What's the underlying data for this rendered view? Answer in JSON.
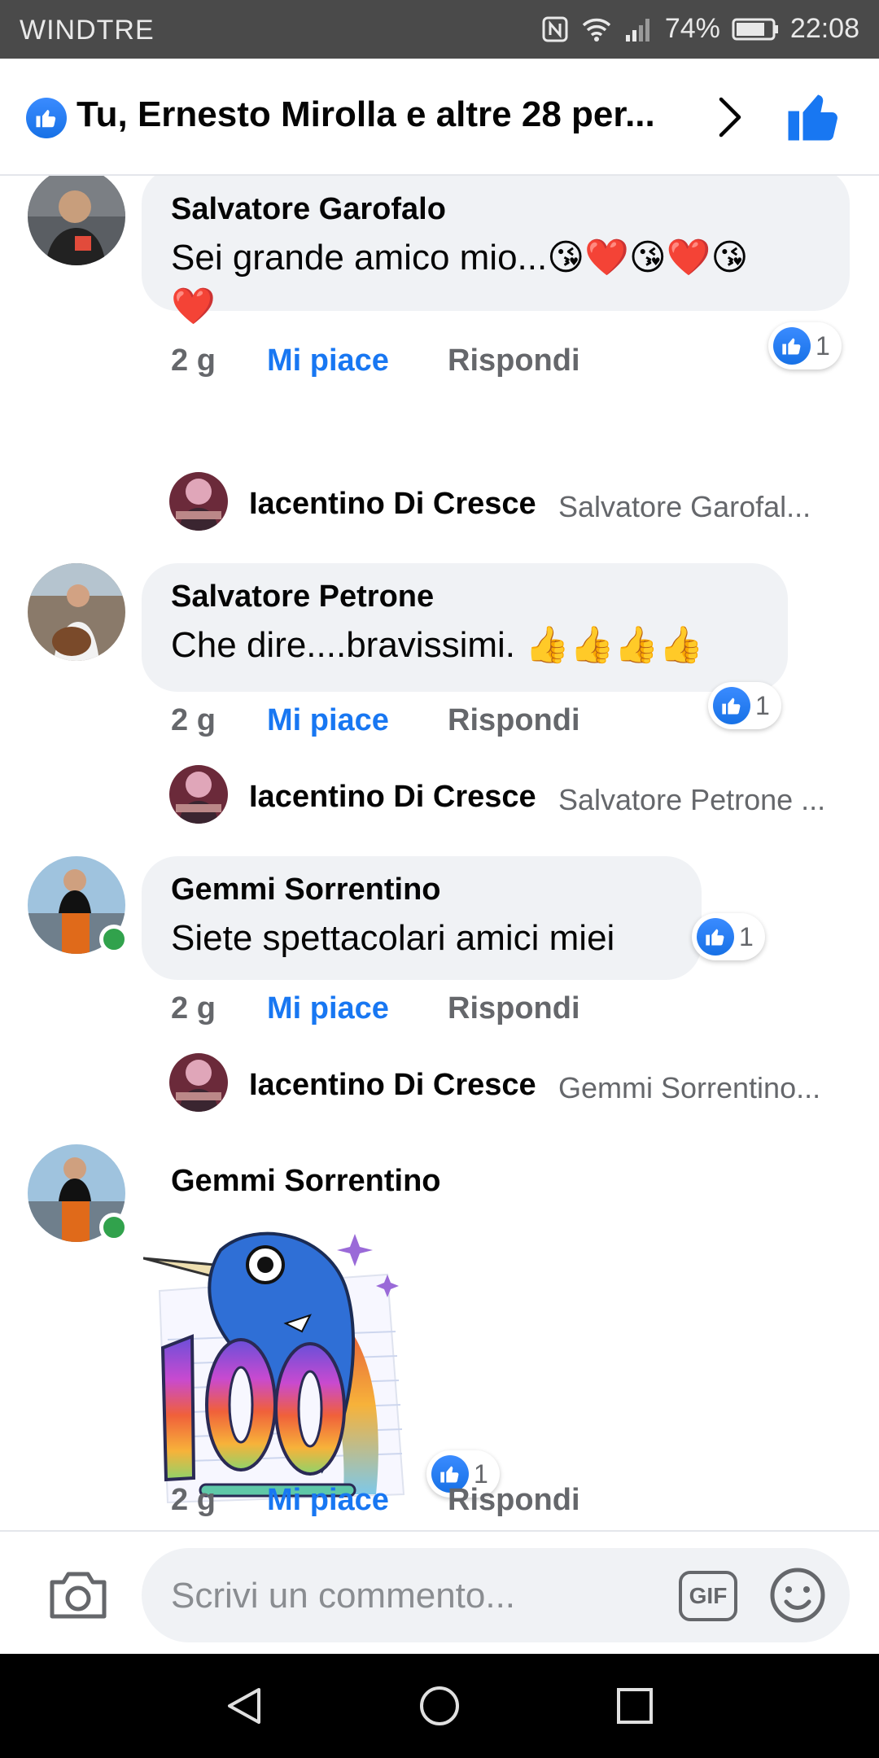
{
  "status_bar": {
    "carrier": "WINDTRE",
    "battery": "74%",
    "time": "22:08"
  },
  "header": {
    "title": "Tu, Ernesto Mirolla e altre 28 per..."
  },
  "comments": [
    {
      "author": "Salvatore Garofalo",
      "text": "Sei grande amico mio...😘❤️😘❤️😘❤️",
      "reactions": "1",
      "time": "2 g",
      "like": "Mi piace",
      "reply": "Rispondi",
      "reply_author": "Iacentino Di Cresce",
      "reply_preview": "Salvatore Garofal..."
    },
    {
      "author": "Salvatore Petrone",
      "text": "Che dire....bravissimi. 👍👍👍👍",
      "reactions": "1",
      "time": "2 g",
      "like": "Mi piace",
      "reply": "Rispondi",
      "reply_author": "Iacentino Di Cresce",
      "reply_preview": "Salvatore Petrone ..."
    },
    {
      "author": "Gemmi Sorrentino",
      "text": "Siete spettacolari amici miei",
      "reactions": "1",
      "time": "2 g",
      "like": "Mi piace",
      "reply": "Rispondi",
      "reply_author": "Iacentino Di Cresce",
      "reply_preview": "Gemmi Sorrentino..."
    },
    {
      "author": "Gemmi Sorrentino",
      "sticker": "100",
      "reactions": "1",
      "time": "2 g",
      "like": "Mi piace",
      "reply": "Rispondi"
    }
  ],
  "composer": {
    "placeholder": "Scrivi un commento...",
    "gif_label": "GIF"
  },
  "colors": {
    "accent": "#1877f2",
    "bubble": "#f0f2f5",
    "online": "#31a24c",
    "muted": "#65676b"
  }
}
